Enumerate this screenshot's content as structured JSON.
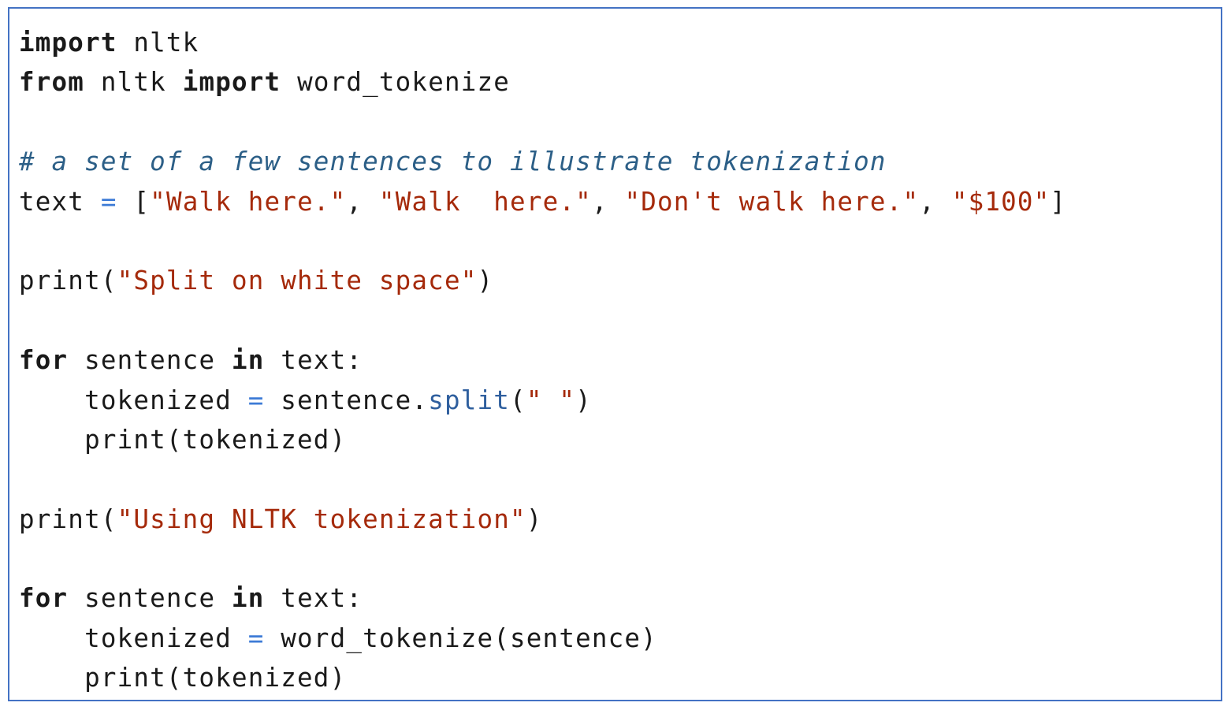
{
  "colors": {
    "border": "#4472c4",
    "keyword": "#1a1a1a",
    "string": "#a52a0b",
    "comment": "#2c5f87",
    "operator": "#3d7bd6",
    "method": "#2f5f9e",
    "text": "#1a1a1a"
  },
  "code_lines": [
    [
      {
        "t": "kw",
        "v": "import"
      },
      {
        "t": "plain",
        "v": " nltk"
      }
    ],
    [
      {
        "t": "kw",
        "v": "from"
      },
      {
        "t": "plain",
        "v": " nltk "
      },
      {
        "t": "kw",
        "v": "import"
      },
      {
        "t": "plain",
        "v": " word_tokenize"
      }
    ],
    [],
    [
      {
        "t": "cm",
        "v": "# a set of a few sentences to illustrate tokenization"
      }
    ],
    [
      {
        "t": "plain",
        "v": "text "
      },
      {
        "t": "op",
        "v": "="
      },
      {
        "t": "plain",
        "v": " ["
      },
      {
        "t": "str",
        "v": "\"Walk here.\""
      },
      {
        "t": "plain",
        "v": ", "
      },
      {
        "t": "str",
        "v": "\"Walk  here.\""
      },
      {
        "t": "plain",
        "v": ", "
      },
      {
        "t": "str",
        "v": "\"Don't walk here.\""
      },
      {
        "t": "plain",
        "v": ", "
      },
      {
        "t": "str",
        "v": "\"$100\""
      },
      {
        "t": "plain",
        "v": "]"
      }
    ],
    [],
    [
      {
        "t": "plain",
        "v": "print("
      },
      {
        "t": "str",
        "v": "\"Split on white space\""
      },
      {
        "t": "plain",
        "v": ")"
      }
    ],
    [],
    [
      {
        "t": "kw",
        "v": "for"
      },
      {
        "t": "plain",
        "v": " sentence "
      },
      {
        "t": "kw",
        "v": "in"
      },
      {
        "t": "plain",
        "v": " text:"
      }
    ],
    [
      {
        "t": "plain",
        "v": "    tokenized "
      },
      {
        "t": "op",
        "v": "="
      },
      {
        "t": "plain",
        "v": " sentence."
      },
      {
        "t": "fn",
        "v": "split"
      },
      {
        "t": "plain",
        "v": "("
      },
      {
        "t": "str",
        "v": "\" \""
      },
      {
        "t": "plain",
        "v": ")"
      }
    ],
    [
      {
        "t": "plain",
        "v": "    print(tokenized)"
      }
    ],
    [],
    [
      {
        "t": "plain",
        "v": "print("
      },
      {
        "t": "str",
        "v": "\"Using NLTK tokenization\""
      },
      {
        "t": "plain",
        "v": ")"
      }
    ],
    [],
    [
      {
        "t": "kw",
        "v": "for"
      },
      {
        "t": "plain",
        "v": " sentence "
      },
      {
        "t": "kw",
        "v": "in"
      },
      {
        "t": "plain",
        "v": " text:"
      }
    ],
    [
      {
        "t": "plain",
        "v": "    tokenized "
      },
      {
        "t": "op",
        "v": "="
      },
      {
        "t": "plain",
        "v": " word_tokenize(sentence)"
      }
    ],
    [
      {
        "t": "plain",
        "v": "    print(tokenized)"
      }
    ]
  ]
}
